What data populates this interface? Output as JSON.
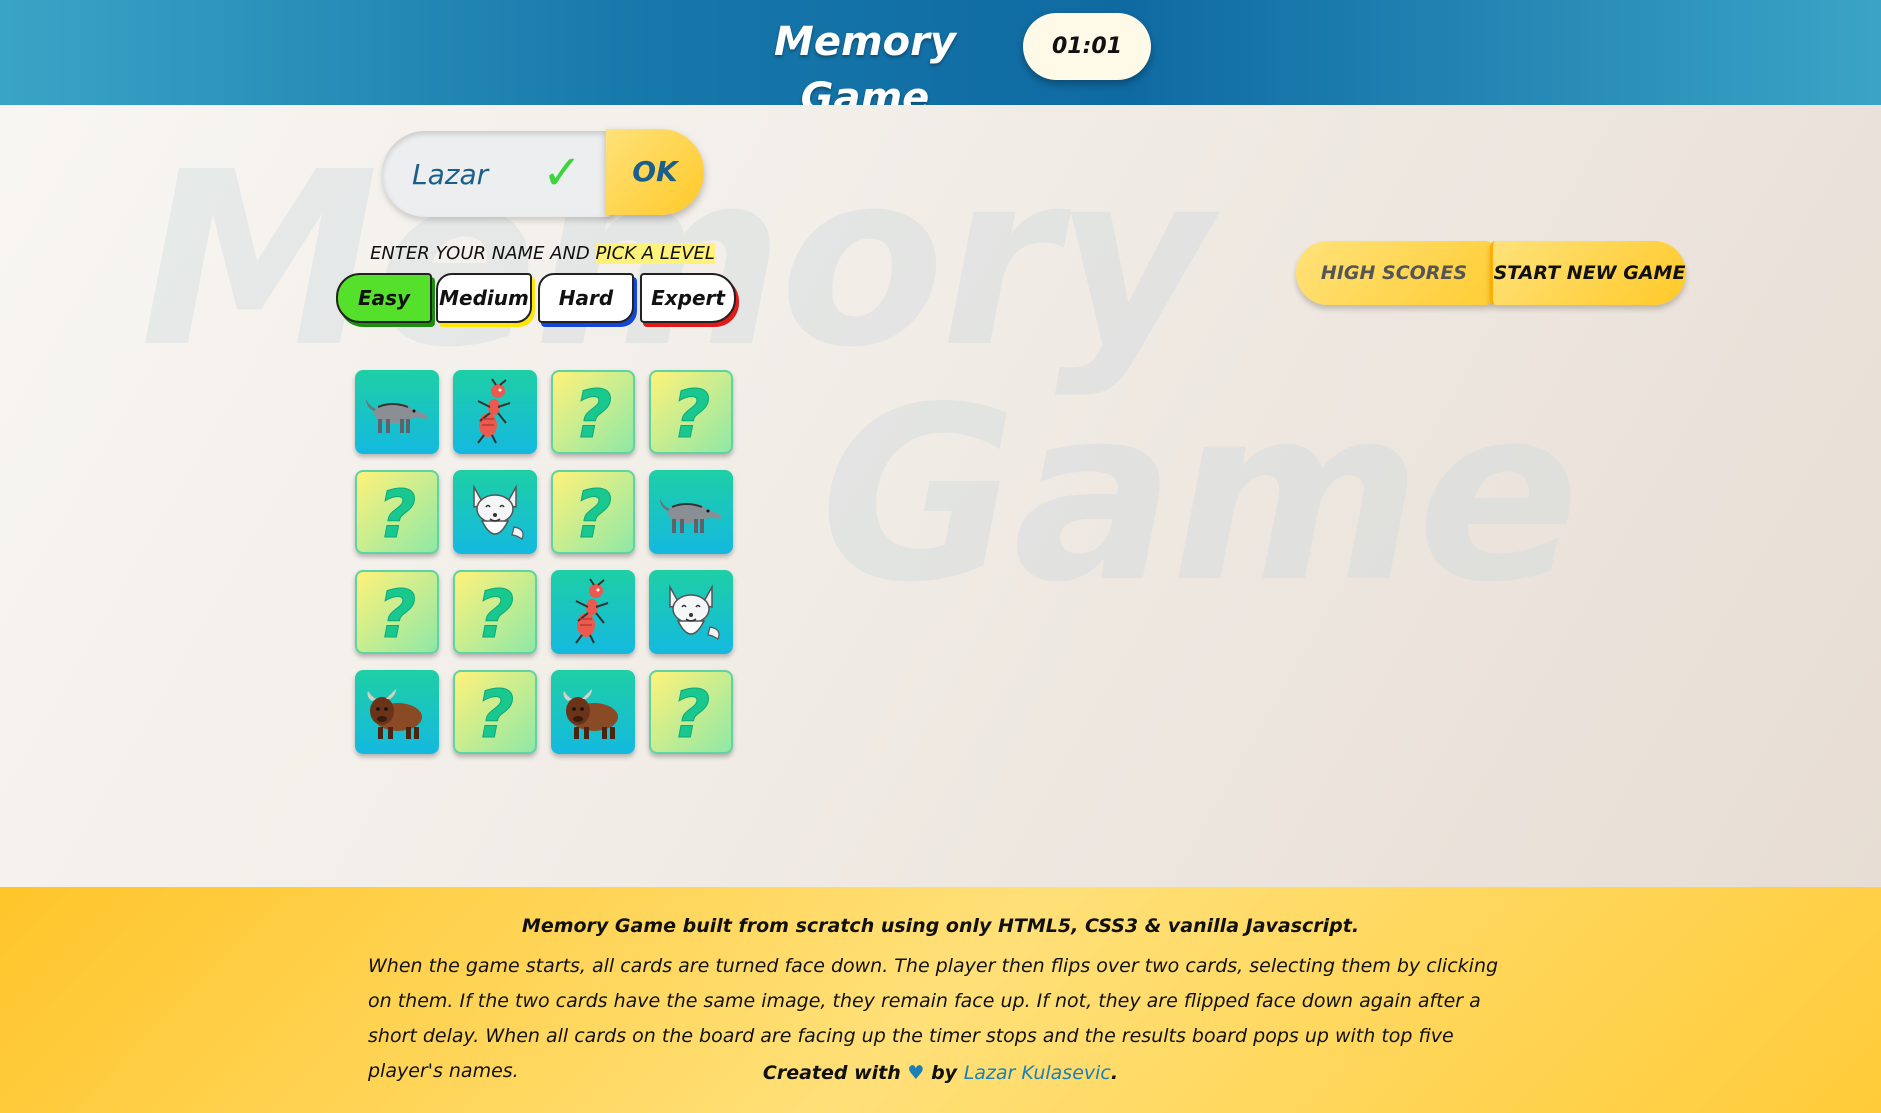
{
  "header": {
    "title": "Memory Game",
    "timer": "01:01"
  },
  "watermark": {
    "line1": "Memory",
    "line2": "Game"
  },
  "name_form": {
    "name_value": "Lazar",
    "ok_label": "OK"
  },
  "instructions": {
    "part1": "ENTER YOUR NAME AND ",
    "part2": "PICK A LEVEL"
  },
  "levels": [
    {
      "label": "Easy",
      "selected": true,
      "accent": "#55e02c"
    },
    {
      "label": "Medium",
      "accent": "#ffe60a"
    },
    {
      "label": "Hard",
      "accent": "#1446d8"
    },
    {
      "label": "Expert",
      "accent": "#e11a1a"
    }
  ],
  "actions": {
    "high_scores_label": "HIGH SCORES",
    "start_new_game_label": "START NEW GAME"
  },
  "board": {
    "cards": [
      "anteater",
      "ant",
      "hidden",
      "hidden",
      "hidden",
      "arctic-fox",
      "hidden",
      "anteater",
      "hidden",
      "hidden",
      "ant",
      "arctic-fox",
      "bison",
      "hidden",
      "bison",
      "hidden"
    ]
  },
  "footer": {
    "heading": "Memory Game built from scratch using only HTML5, CSS3 & vanilla Javascript.",
    "description": "When the game starts, all cards are turned face down. The player then flips over two cards, selecting them by clicking on them. If the two cards have the same image, they remain face up. If not, they are flipped face down again after a short delay. When all cards on the board are facing up the timer stops and the results board pops up with top five player's names.",
    "credit_prefix": "Created with",
    "credit_heart": "♥",
    "credit_by": "by",
    "credit_author": "Lazar Kulasevic",
    "credit_suffix": "."
  },
  "colors": {
    "header_blue": "#1677aa",
    "accent_yellow": "#ffc928",
    "link_blue": "#1c7fb5"
  }
}
